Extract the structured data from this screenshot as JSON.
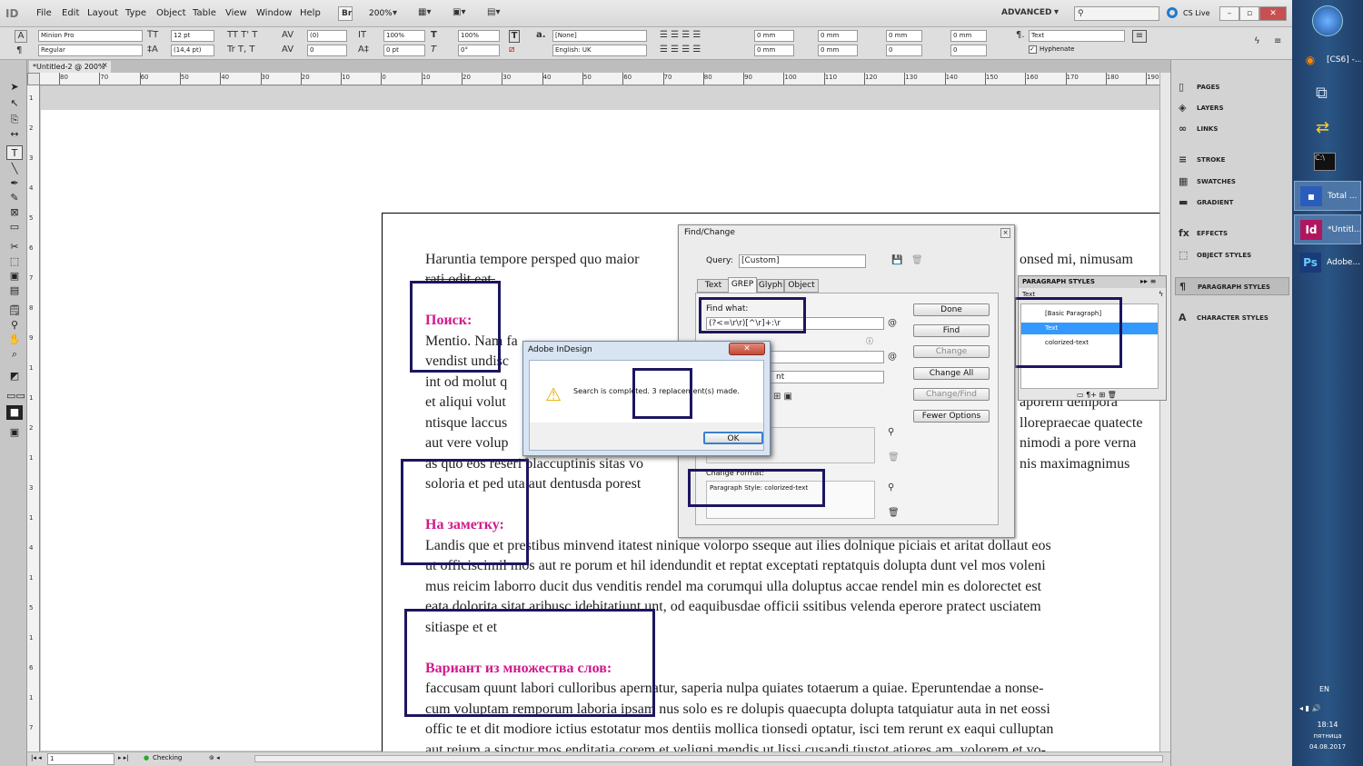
{
  "menubar": {
    "app_icon": "ID",
    "items": [
      "File",
      "Edit",
      "Layout",
      "Type",
      "Object",
      "Table",
      "View",
      "Window",
      "Help"
    ],
    "bridge": "Br",
    "zoom": "200%",
    "workspace": "ADVANCED",
    "search_placeholder": "",
    "cslive": "CS Live"
  },
  "control": {
    "font_family": "Minion Pro",
    "font_style": "Regular",
    "font_size": "12 pt",
    "leading": "(14,4 pt)",
    "kerning": "(0)",
    "tracking": "0",
    "vscale": "100%",
    "hscale": "100%",
    "baseline": "0 pt",
    "skew": "0°",
    "char_style": "[None]",
    "language": "English: UK",
    "indent_l": "0 mm",
    "indent_r": "0 mm",
    "indent_fl": "0 mm",
    "indent_ll": "0 mm",
    "space_b": "0 mm",
    "space_a": "0 mm",
    "dropcap_l": "0",
    "dropcap_c": "0",
    "para_style": "Text",
    "hyphenate": "Hyphenate"
  },
  "doc_tab": "*Untitled-2 @ 200%",
  "ruler_labels": [
    "80",
    "70",
    "60",
    "50",
    "40",
    "30",
    "20",
    "10",
    "0",
    "10",
    "20",
    "30",
    "40",
    "50",
    "60",
    "70",
    "80",
    "90",
    "100",
    "110",
    "120",
    "130",
    "140",
    "150",
    "160",
    "170",
    "180",
    "190"
  ],
  "vruler_labels": [
    "1",
    "2",
    "3",
    "4",
    "5",
    "6",
    "7",
    "8",
    "9",
    "1",
    "1",
    "2",
    "1",
    "3",
    "1",
    "4",
    "1",
    "5",
    "1",
    "6",
    "1",
    "7"
  ],
  "body": {
    "l1": "Haruntia tempore persped quo maior",
    "l1b": "onsed mi, nimusam",
    "l2": "rati odit eat.",
    "h1": "Поиск:",
    "l3": "Mentio. Nam fa",
    "l4": "vendist undisc",
    "l5": "int od molut q",
    "l6": "et aliqui volut",
    "l6b": "aporem dempora",
    "l7": "ntisque laccus",
    "l7b": "llorepraecae quatecte",
    "l8": "aut vere volup",
    "l8b": "nimodi a pore verna",
    "l9": "as quo eos reseri blaccuptinis sitas vo",
    "l9b": "nis maximagnimus",
    "l10": "soloria et ped uta aut dentusda porest",
    "h2": "На заметку:",
    "l11": "Landis que et prestibus minvend itatest ninique volorpo sseque aut ilies dolnique piciais et aritat dollaut eos",
    "l12": "ut officiscimil mos aut re porum et hil idendundit et reptat exceptati reptatquis dolupta dunt vel mos voleni",
    "l13": "mus reicim laborro ducit dus venditis rendel ma corumqui ulla doluptus accae rendel min es dolorectet est",
    "l14": "eata dolorita sitat aribusc idebitatiunt unt, od eaquibusdae officii ssitibus velenda eperore pratect usciatem",
    "l15": "sitiaspe et et",
    "h3": "Вариант из множества слов:",
    "l16": " faccusam quunt labori culloribus apernatur, saperia nulpa quiates totaerum a quiae. Eperuntendae a nonse-",
    "l17": "cum voluptam remporum laboria ipsam nus solo es re dolupis quaecupta dolupta tatquiatur auta in net eossi",
    "l18": "offic te et dit modiore ictius estotatur mos dentiis mollica tionsedi optatur, isci tem rerunt ex eaqui culluptan",
    "l19": "aut reium a sinctur mos enditatia corem et veligni mendis ut lissi cusandi tiustot atiores am, volorem et vo-"
  },
  "findchange": {
    "title": "Find/Change",
    "query_label": "Query:",
    "query_value": "[Custom]",
    "tabs": [
      "Text",
      "GREP",
      "Glyph",
      "Object"
    ],
    "find_label": "Find what:",
    "find_value": "(?<=\\r\\r)[^\\r]+:\\r",
    "change_partial": "nt",
    "format_label": "Change Format:",
    "format_value": "Paragraph Style: colorized-text",
    "buttons": {
      "done": "Done",
      "find": "Find",
      "change": "Change",
      "change_all": "Change All",
      "change_find": "Change/Find",
      "fewer": "Fewer Options"
    }
  },
  "alert": {
    "title": "Adobe InDesign",
    "message": "Search is completed.  3 replacement(s) made.",
    "ok": "OK"
  },
  "parastyles": {
    "title": "PARAGRAPH STYLES",
    "header": "Text",
    "items": [
      "[Basic Paragraph]",
      "Text",
      "colorized-text"
    ]
  },
  "panels": {
    "items": [
      "PAGES",
      "LAYERS",
      "LINKS",
      "STROKE",
      "SWATCHES",
      "GRADIENT",
      "EFFECTS",
      "OBJECT STYLES",
      "PARAGRAPH STYLES",
      "CHARACTER STYLES"
    ]
  },
  "status": {
    "page": "1",
    "check": "Checking"
  },
  "taskbar": {
    "items": [
      "[CS6] -...",
      "Total ...",
      "*Untitl...",
      "Adobe..."
    ],
    "lang": "EN",
    "time": "18:14",
    "day": "пятница",
    "date": "04.08.2017"
  },
  "colors": {
    "heading": "#d0198b",
    "highlight": "#1c1660",
    "selection": "#3399ff"
  }
}
